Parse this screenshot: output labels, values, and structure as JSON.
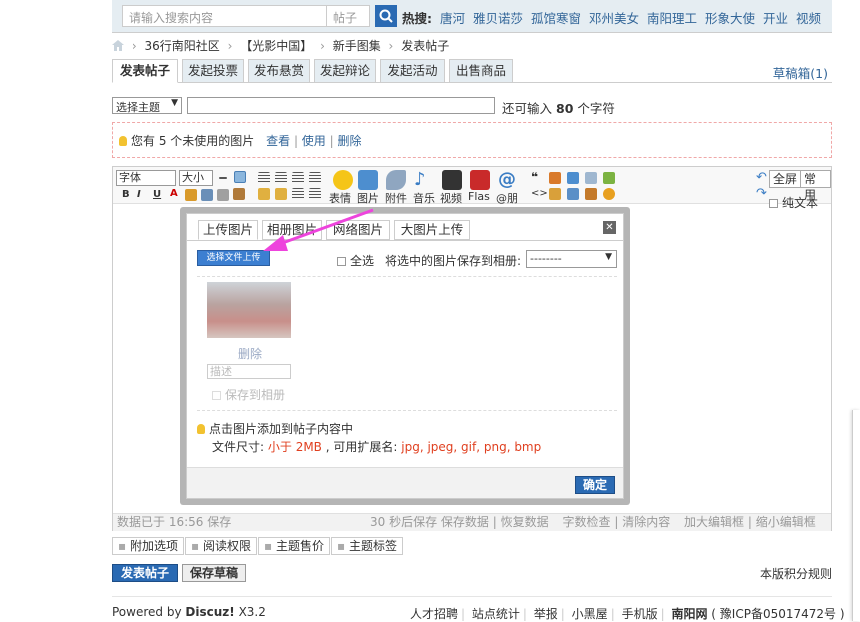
{
  "search": {
    "placeholder": "请输入搜索内容",
    "type": "帖子"
  },
  "hot": {
    "label": "热搜:",
    "keywords": [
      "唐河",
      "雅贝诺莎",
      "孤馆寒窗",
      "邓州美女",
      "南阳理工",
      "形象大使",
      "开业",
      "视频"
    ]
  },
  "breadcrumb": [
    "36行南阳社区",
    "【光影中国】",
    "新手图集",
    "发表帖子"
  ],
  "tabs": [
    "发表帖子",
    "发起投票",
    "发布悬赏",
    "发起辩论",
    "发起活动",
    "出售商品"
  ],
  "drafts": "草稿箱(1)",
  "subject": {
    "select": "选择主题",
    "count_prefix": "还可输入",
    "count_value": "80",
    "count_suffix": "个字符"
  },
  "notice": {
    "text": "您有 5 个未使用的图片",
    "view": "查看",
    "use": "使用",
    "delete": "删除"
  },
  "toolbar": {
    "font": "字体",
    "size": "大小",
    "fmt": [
      "B",
      "I",
      "U",
      "A"
    ],
    "big": [
      "表情",
      "图片",
      "附件",
      "音乐",
      "视频",
      "Flas",
      "@朋"
    ],
    "fullscreen": "全屏",
    "common": "常用",
    "plain": "纯文本"
  },
  "status": {
    "saved": "数据已于 16:56 保存",
    "autosave": "30 秒后保存",
    "links": [
      "保存数据",
      "恢复数据",
      "字数检查",
      "清除内容",
      "加大编辑框",
      "缩小编辑框"
    ]
  },
  "dialog": {
    "tabs": [
      "上传图片",
      "相册图片",
      "网络图片",
      "大图片上传"
    ],
    "select_file": "选择文件上传",
    "select_all": "全选",
    "save_to": "将选中的图片保存到相册:",
    "album": "--------",
    "thumb_delete": "删除",
    "thumb_desc": "描述",
    "thumb_save": "保存到相册",
    "hint": "点击图片添加到帖子内容中",
    "size_label": "文件尺寸:",
    "size_value": "小于 2MB",
    "ext_label": ", 可用扩展名:",
    "ext_value": "jpg, jpeg, gif, png, bmp",
    "ok": "确定"
  },
  "options": [
    "附加选项",
    "阅读权限",
    "主题售价",
    "主题标签"
  ],
  "actions": {
    "post": "发表帖子",
    "draft": "保存草稿",
    "rules": "本版积分规则"
  },
  "footer": {
    "powered_prefix": "Powered by",
    "brand": "Discuz!",
    "version": "X3.2",
    "links": [
      "人才招聘",
      "站点统计",
      "举报",
      "小黑屋",
      "手机版"
    ],
    "site": "南阳网",
    "icp": "( 豫ICP备05017472号 )"
  },
  "colors": {
    "accent": "#2a6ab3",
    "link": "#336699",
    "warn": "#e04020",
    "arrow": "#ee44dd"
  }
}
